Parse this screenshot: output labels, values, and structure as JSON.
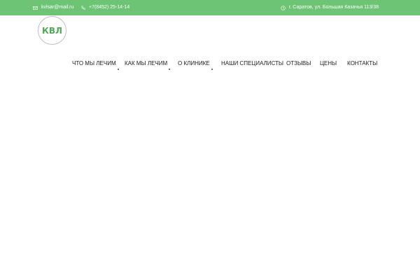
{
  "topbar": {
    "email": "kvlsar@mail.ru",
    "phone": "+7(8452) 25-14-14",
    "address": "г. Саратов, ул. Большая Казачья 113/38",
    "email_icon": "envelope-icon",
    "phone_icon": "phone-icon",
    "address_icon": "clock-icon",
    "background_color": "#6cc474"
  },
  "logo": {
    "text": "КВЛ",
    "color": "#4daa57"
  },
  "nav": {
    "items": [
      {
        "label": "ЧТО МЫ ЛЕЧИМ",
        "has_submenu": true
      },
      {
        "label": "КАК МЫ ЛЕЧИМ",
        "has_submenu": true
      },
      {
        "label": "О КЛИНИКЕ",
        "has_submenu": true
      },
      {
        "label": "НАШИ СПЕЦИАЛИСТЫ",
        "has_submenu": false
      },
      {
        "label": "ОТЗЫВЫ",
        "has_submenu": false
      },
      {
        "label": "ЦЕНЫ",
        "has_submenu": false
      },
      {
        "label": "КОНТАКТЫ",
        "has_submenu": false
      }
    ]
  }
}
